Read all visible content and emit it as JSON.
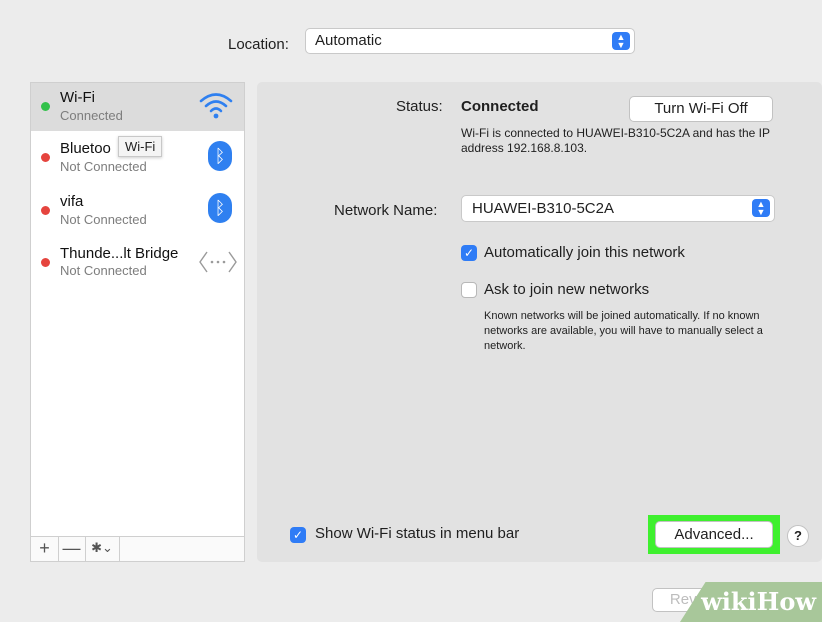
{
  "location": {
    "label": "Location:",
    "value": "Automatic"
  },
  "sidebar": {
    "services": [
      {
        "name": "Wi-Fi",
        "status": "Connected",
        "state": "green",
        "icon": "wifi-icon"
      },
      {
        "name": "Bluetoo",
        "status": "Not Connected",
        "state": "red",
        "icon": "bluetooth-icon"
      },
      {
        "name": "vifa",
        "status": "Not Connected",
        "state": "red",
        "icon": "bluetooth-icon"
      },
      {
        "name": "Thunde...lt Bridge",
        "status": "Not Connected",
        "state": "red",
        "icon": "thunderbolt-bridge-icon"
      }
    ],
    "tooltip": "Wi-Fi",
    "add_label": "+",
    "remove_label": "—",
    "action_label": "✱⌄"
  },
  "details": {
    "status_label": "Status:",
    "status_value": "Connected",
    "turn_off_label": "Turn Wi-Fi Off",
    "status_description": "Wi-Fi is connected to HUAWEI-B310-5C2A and has the IP address 192.168.8.103.",
    "network_name_label": "Network Name:",
    "network_name_value": "HUAWEI-B310-5C2A",
    "auto_join_label": "Automatically join this network",
    "auto_join_checked": true,
    "ask_join_label": "Ask to join new networks",
    "ask_join_checked": false,
    "ask_join_description": "Known networks will be joined automatically. If no known networks are available, you will have to manually select a network.",
    "show_status_label": "Show Wi-Fi status in menu bar",
    "show_status_checked": true,
    "advanced_label": "Advanced...",
    "help_label": "?",
    "revert_label": "Revert"
  },
  "watermark": "wikiHow",
  "colors": {
    "selection_highlight": "#3ef02e",
    "accent": "#2f7cf6",
    "connected": "#32c14a",
    "disconnected": "#e5443e"
  }
}
